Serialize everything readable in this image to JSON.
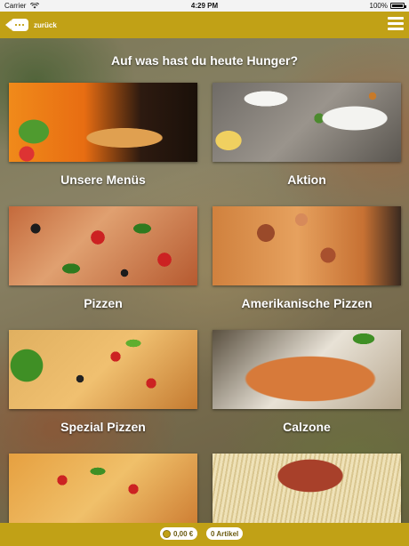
{
  "status_bar": {
    "carrier": "Carrier",
    "time": "4:29 PM",
    "battery": "100%"
  },
  "header": {
    "back_label": "zurück"
  },
  "main": {
    "question": "Auf was hast du heute Hunger?",
    "categories": [
      {
        "label": "Unsere Menüs"
      },
      {
        "label": "Aktion"
      },
      {
        "label": "Pizzen"
      },
      {
        "label": "Amerikanische Pizzen"
      },
      {
        "label": "Spezial Pizzen"
      },
      {
        "label": "Calzone"
      },
      {
        "label": ""
      },
      {
        "label": ""
      }
    ]
  },
  "footer": {
    "cart_total": "0,00 €",
    "cart_items": "0 Artikel"
  },
  "colors": {
    "accent": "#c1a116"
  }
}
